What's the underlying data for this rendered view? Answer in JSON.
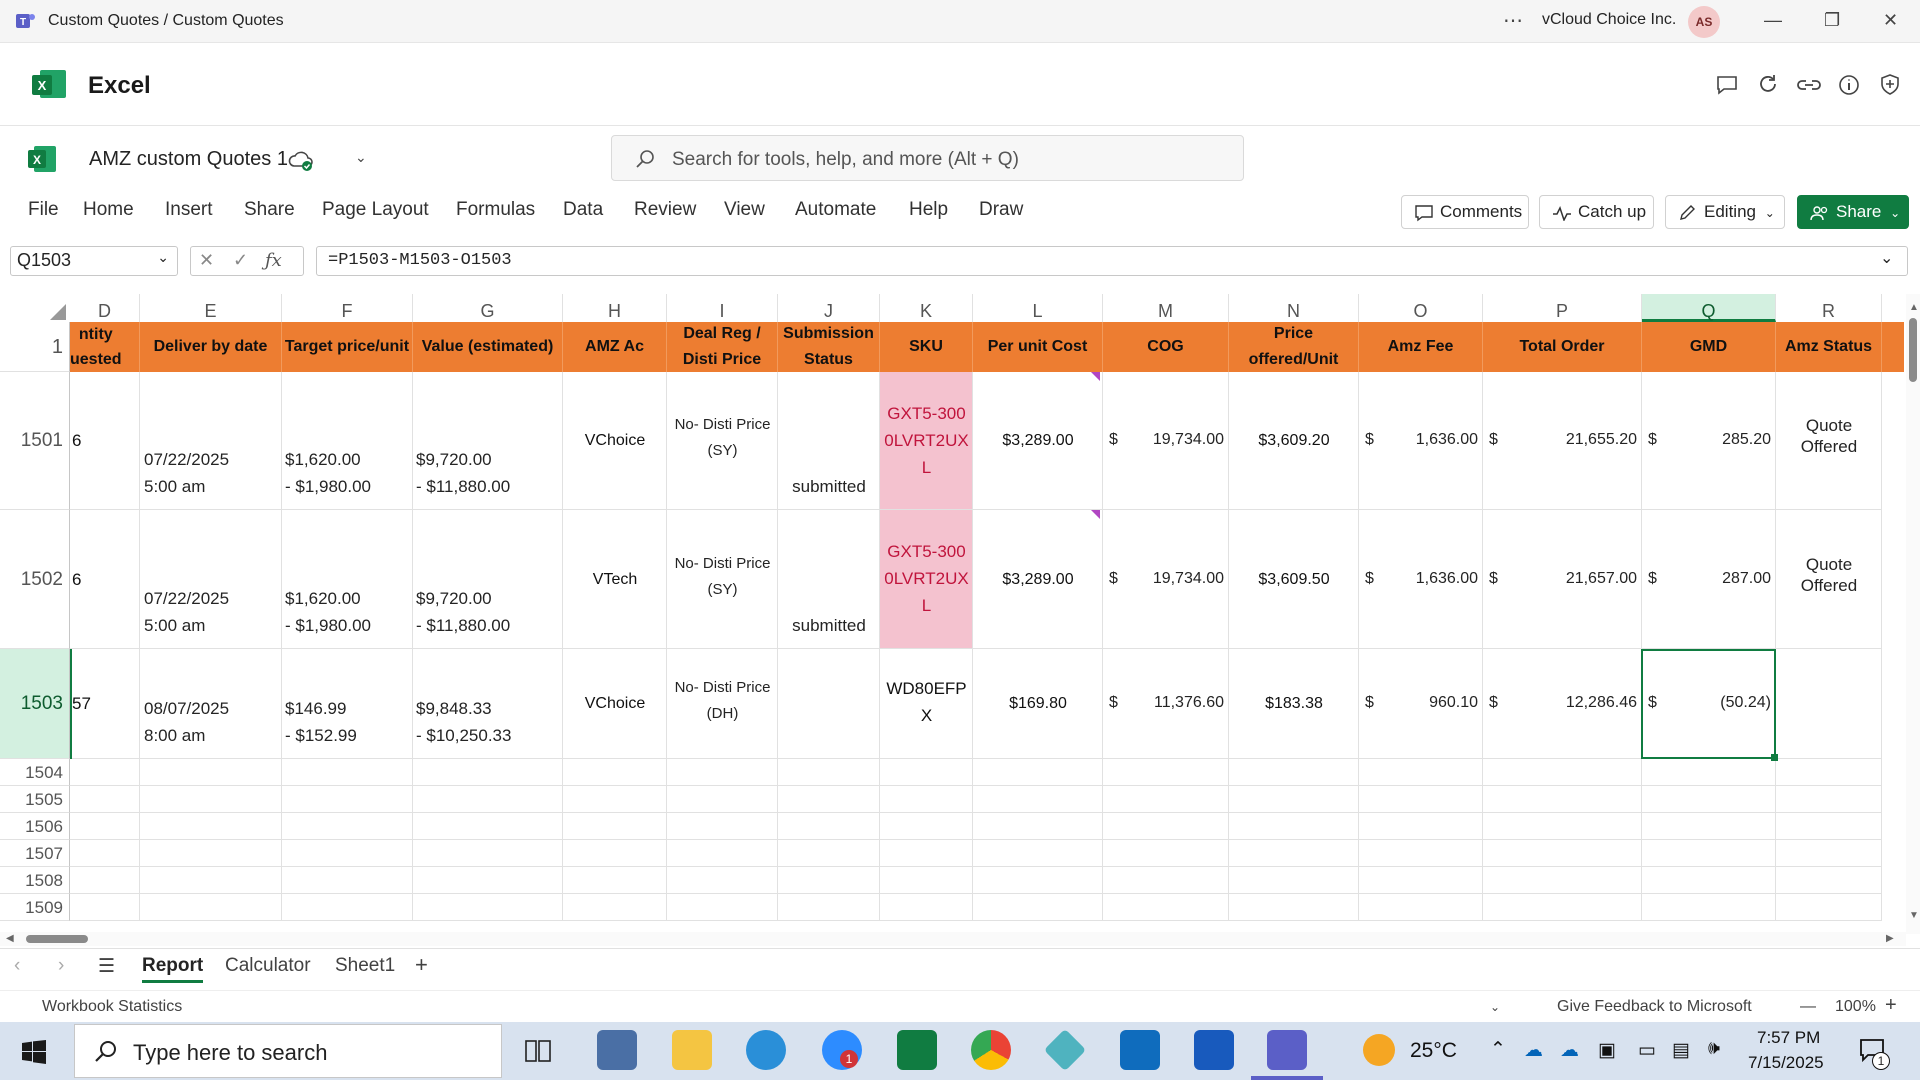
{
  "window": {
    "title": "Custom Quotes / Custom Quotes",
    "org": "vCloud Choice Inc.",
    "avatar": "AS"
  },
  "app": {
    "name": "Excel"
  },
  "doc": {
    "title": "AMZ custom Quotes 1"
  },
  "search": {
    "placeholder": "Search for tools, help, and more (Alt + Q)"
  },
  "menu": [
    "File",
    "Home",
    "Insert",
    "Share",
    "Page Layout",
    "Formulas",
    "Data",
    "Review",
    "View",
    "Automate",
    "Help",
    "Draw"
  ],
  "ribbon_buttons": {
    "comments": "Comments",
    "catchup": "Catch up",
    "editing": "Editing",
    "share": "Share"
  },
  "formula_bar": {
    "name_box": "Q1503",
    "formula": "=P1503-M1503-O1503"
  },
  "columns": [
    "D",
    "E",
    "F",
    "G",
    "H",
    "I",
    "J",
    "K",
    "L",
    "M",
    "N",
    "O",
    "P",
    "Q",
    "R"
  ],
  "header_row": {
    "row_number": "1",
    "cells": [
      "ntity\nuested",
      "Deliver by date",
      "Target price/unit",
      "Value (estimated)",
      "AMZ Ac",
      "Deal Reg /\nDisti Price",
      "Submission\nStatus",
      "SKU",
      "Per unit Cost",
      "COG",
      "Price\noffered/Unit",
      "Amz Fee",
      "Total Order",
      "GMD",
      "Amz Status"
    ]
  },
  "rows": [
    {
      "num": "1501",
      "qty": "6",
      "deliver_date": "07/22/2025",
      "deliver_time": "5:00 am",
      "target_a": "$1,620.00",
      "target_b": "- $1,980.00",
      "value_a": "$9,720.00",
      "value_b": "- $11,880.00",
      "amz_ac": "VChoice",
      "disti_a": "No- Disti Price",
      "disti_b": "(SY)",
      "status": "submitted",
      "sku_a": "GXT5-300",
      "sku_b": "0LVRT2UX",
      "sku_c": "L",
      "unit_cost": "$3,289.00",
      "cog_sym": "$",
      "cog": "19,734.00",
      "price_offered": "$3,609.20",
      "fee_sym": "$",
      "fee": "1,636.00",
      "total_sym": "$",
      "total": "21,655.20",
      "gmd_sym": "$",
      "gmd": "285.20",
      "amz_status_a": "Quote",
      "amz_status_b": "Offered"
    },
    {
      "num": "1502",
      "qty": "6",
      "deliver_date": "07/22/2025",
      "deliver_time": "5:00 am",
      "target_a": "$1,620.00",
      "target_b": "- $1,980.00",
      "value_a": "$9,720.00",
      "value_b": "- $11,880.00",
      "amz_ac": "VTech",
      "disti_a": "No- Disti Price",
      "disti_b": "(SY)",
      "status": "submitted",
      "sku_a": "GXT5-300",
      "sku_b": "0LVRT2UX",
      "sku_c": "L",
      "unit_cost": "$3,289.00",
      "cog_sym": "$",
      "cog": "19,734.00",
      "price_offered": "$3,609.50",
      "fee_sym": "$",
      "fee": "1,636.00",
      "total_sym": "$",
      "total": "21,657.00",
      "gmd_sym": "$",
      "gmd": "287.00",
      "amz_status_a": "Quote",
      "amz_status_b": "Offered"
    },
    {
      "num": "1503",
      "qty": "57",
      "deliver_date": "08/07/2025",
      "deliver_time": "8:00 am",
      "target_a": "$146.99",
      "target_b": "- $152.99",
      "value_a": "$9,848.33",
      "value_b": "- $10,250.33",
      "amz_ac": "VChoice",
      "disti_a": "No- Disti Price",
      "disti_b": "(DH)",
      "status": "",
      "sku_a": "WD80EFP",
      "sku_b": "X",
      "sku_c": "",
      "unit_cost": "$169.80",
      "cog_sym": "$",
      "cog": "11,376.60",
      "price_offered": "$183.38",
      "fee_sym": "$",
      "fee": "960.10",
      "total_sym": "$",
      "total": "12,286.46",
      "gmd_sym": "$",
      "gmd": "(50.24)",
      "amz_status_a": "",
      "amz_status_b": ""
    }
  ],
  "empty_rows": [
    "1504",
    "1505",
    "1506",
    "1507",
    "1508",
    "1509"
  ],
  "sheet_tabs": [
    "Report",
    "Calculator",
    "Sheet1"
  ],
  "status_bar": {
    "left": "Workbook Statistics",
    "feedback": "Give Feedback to Microsoft",
    "zoom": "100%"
  },
  "taskbar": {
    "search_placeholder": "Type here to search",
    "weather": "25°C",
    "time": "7:57 PM",
    "date": "7/15/2025",
    "zoom_badge": "1",
    "notif_badge": "1"
  },
  "colors": {
    "header_orange": "#ed7d31",
    "excel_green": "#107c41",
    "sku_pink": "#f4c2cf",
    "sku_text": "#c0143c"
  }
}
